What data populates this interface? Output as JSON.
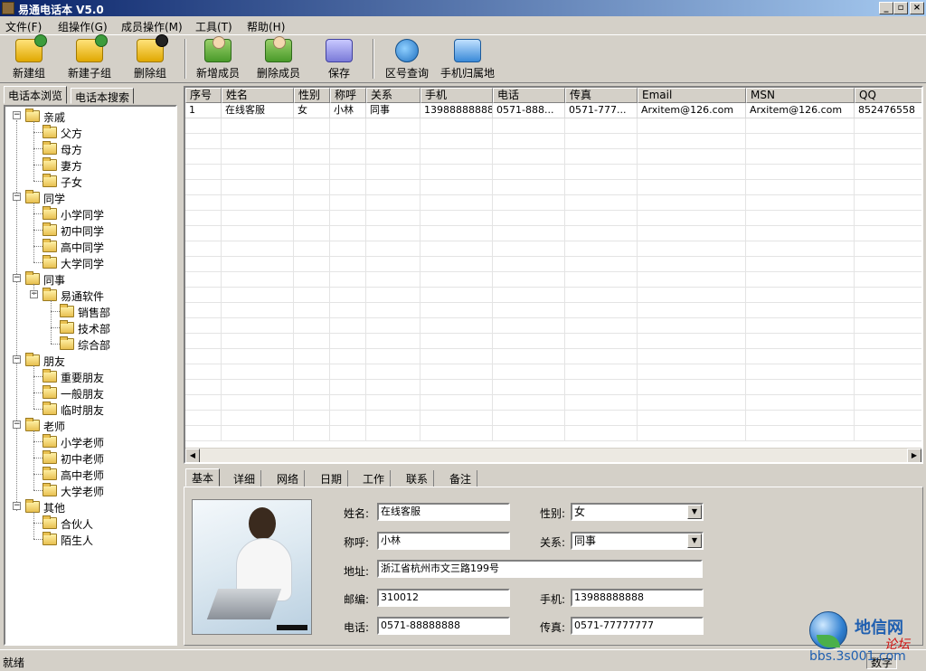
{
  "window": {
    "title": "易通电话本 V5.0",
    "minimize": "_",
    "maximize": "▫",
    "close": "×"
  },
  "menu": [
    "文件(F)",
    "组操作(G)",
    "成员操作(M)",
    "工具(T)",
    "帮助(H)"
  ],
  "toolbar": [
    {
      "label": "新建组",
      "icon": "new-group-icon"
    },
    {
      "label": "新建子组",
      "icon": "new-subgroup-icon"
    },
    {
      "label": "删除组",
      "icon": "delete-group-icon"
    },
    {
      "label": "新增成员",
      "icon": "add-member-icon"
    },
    {
      "label": "删除成员",
      "icon": "delete-member-icon"
    },
    {
      "label": "保存",
      "icon": "save-icon"
    },
    {
      "label": "区号查询",
      "icon": "area-code-icon"
    },
    {
      "label": "手机归属地",
      "icon": "mobile-location-icon"
    }
  ],
  "left_tabs": [
    "电话本浏览",
    "电话本搜索"
  ],
  "tree": [
    {
      "label": "亲戚",
      "level": 0
    },
    {
      "label": "父方",
      "level": 1
    },
    {
      "label": "母方",
      "level": 1
    },
    {
      "label": "妻方",
      "level": 1
    },
    {
      "label": "子女",
      "level": 1
    },
    {
      "label": "同学",
      "level": 0
    },
    {
      "label": "小学同学",
      "level": 1
    },
    {
      "label": "初中同学",
      "level": 1
    },
    {
      "label": "高中同学",
      "level": 1
    },
    {
      "label": "大学同学",
      "level": 1
    },
    {
      "label": "同事",
      "level": 0
    },
    {
      "label": "易通软件",
      "level": 1
    },
    {
      "label": "销售部",
      "level": 2
    },
    {
      "label": "技术部",
      "level": 2
    },
    {
      "label": "综合部",
      "level": 2
    },
    {
      "label": "朋友",
      "level": 0
    },
    {
      "label": "重要朋友",
      "level": 1
    },
    {
      "label": "一般朋友",
      "level": 1
    },
    {
      "label": "临时朋友",
      "level": 1
    },
    {
      "label": "老师",
      "level": 0
    },
    {
      "label": "小学老师",
      "level": 1
    },
    {
      "label": "初中老师",
      "level": 1
    },
    {
      "label": "高中老师",
      "level": 1
    },
    {
      "label": "大学老师",
      "level": 1
    },
    {
      "label": "其他",
      "level": 0
    },
    {
      "label": "合伙人",
      "level": 1
    },
    {
      "label": "陌生人",
      "level": 1
    }
  ],
  "grid": {
    "columns": [
      "序号",
      "姓名",
      "性别",
      "称呼",
      "关系",
      "手机",
      "电话",
      "传真",
      "Email",
      "MSN",
      "QQ"
    ],
    "rows": [
      [
        "1",
        "在线客服",
        "女",
        "小林",
        "同事",
        "13988888888",
        "0571-888...",
        "0571-777...",
        "Arxitem@126.com",
        "Arxitem@126.com",
        "852476558"
      ]
    ]
  },
  "detail_tabs": [
    "基本",
    "详细",
    "网络",
    "日期",
    "工作",
    "联系",
    "备注"
  ],
  "form": {
    "name_label": "姓名:",
    "name": "在线客服",
    "gender_label": "性别:",
    "gender": "女",
    "nickname_label": "称呼:",
    "nickname": "小林",
    "relation_label": "关系:",
    "relation": "同事",
    "address_label": "地址:",
    "address": "浙江省杭州市文三路199号",
    "postcode_label": "邮编:",
    "postcode": "310012",
    "mobile_label": "手机:",
    "mobile": "13988888888",
    "phone_label": "电话:",
    "phone": "0571-88888888",
    "fax_label": "传真:",
    "fax": "0571-77777777"
  },
  "status": {
    "text": "就绪",
    "mode": "数字"
  },
  "watermark": {
    "name": "地信网",
    "sub": "论坛",
    "url": "bbs.3s001.com"
  }
}
